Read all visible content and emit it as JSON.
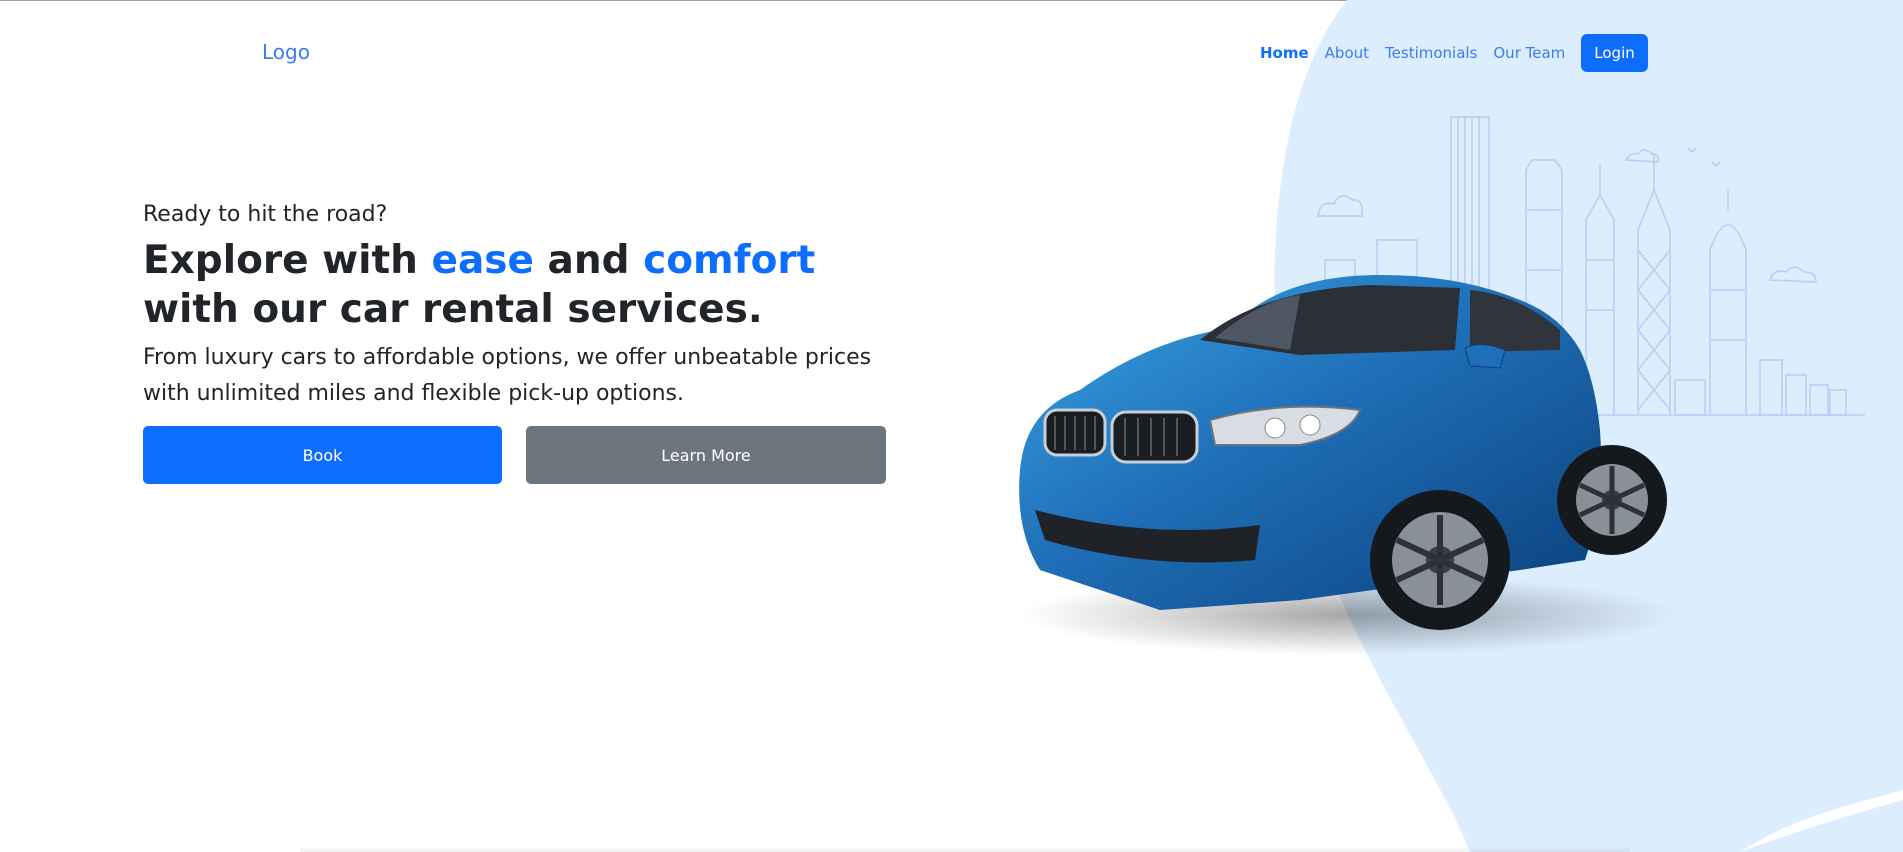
{
  "nav": {
    "logo": "Logo",
    "links": [
      "Home",
      "About",
      "Testimonials",
      "Our Team"
    ],
    "active": "Home",
    "login_label": "Login"
  },
  "hero": {
    "kicker": "Ready to hit the road?",
    "headline_parts": [
      "Explore with ",
      "ease",
      " and ",
      "comfort",
      " with our car rental services."
    ],
    "subtitle": "From luxury cars to affordable options, we offer unbeatable prices with unlimited miles and flexible pick-up options.",
    "book_label": "Book",
    "learn_label": "Learn More"
  },
  "colors": {
    "primary": "#0d6efd",
    "secondary": "#6c757d",
    "blob": "#dcedfe",
    "skyline": "#b9cdf7"
  },
  "icons": {
    "car": "car-image",
    "skyline": "city-skyline-illustration"
  }
}
